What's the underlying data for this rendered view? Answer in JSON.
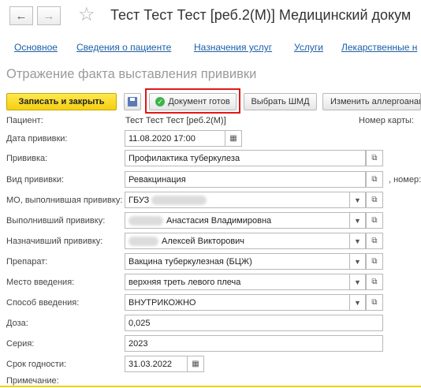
{
  "header": {
    "back_icon": "arrow-left-icon",
    "forward_icon": "arrow-right-icon",
    "favorite_icon": "star-icon",
    "title": "Тест Тест Тест [реб.2(М)] Медицинский докум"
  },
  "tabs": [
    {
      "label": "Основное"
    },
    {
      "label": "Сведения о пациенте"
    },
    {
      "label": "Назначения услуг"
    },
    {
      "label": "Услуги"
    },
    {
      "label": "Лекарственные н"
    }
  ],
  "subtitle": "Отражение факта выставления прививки",
  "toolbar": {
    "save_close_label": "Записать и закрыть",
    "doc_ready_label": "Документ готов",
    "select_shmd_label": "Выбрать ШМД",
    "change_allergy_label": "Изменить аллергоанам",
    "highlight_color": "#e01818",
    "accent_color": "#f4d012"
  },
  "form": {
    "patient_label": "Пациент:",
    "patient_value": "Тест Тест Тест [реб.2(М)]",
    "card_label": "Номер карты:",
    "date_label": "Дата прививки:",
    "date_value": "11.08.2020 17:00",
    "vaccination_label": "Прививка:",
    "vaccination_value": "Профилактика туберкулеза",
    "type_label": "Вид прививки:",
    "type_value": "Ревакцинация",
    "number_label": ", номер:",
    "mo_label": "МО, выполнившая прививку:",
    "mo_value": "ГБУЗ",
    "performer_label": "Выполнивший прививку:",
    "performer_value": "Анастасия Владимировна",
    "assigner_label": "Назначивший прививку:",
    "assigner_value": "Алексей Викторович",
    "drug_label": "Препарат:",
    "drug_value": "Вакцина туберкулезная (БЦЖ)",
    "site_label": "Место введения:",
    "site_value": "верхняя треть левого плеча",
    "method_label": "Способ введения:",
    "method_value": "ВНУТРИКОЖНО",
    "dose_label": "Доза:",
    "dose_value": "0,025",
    "series_label": "Серия:",
    "series_value": "2023",
    "expiry_label": "Срок годности:",
    "expiry_value": "31.03.2022",
    "note_label": "Примечание:"
  }
}
